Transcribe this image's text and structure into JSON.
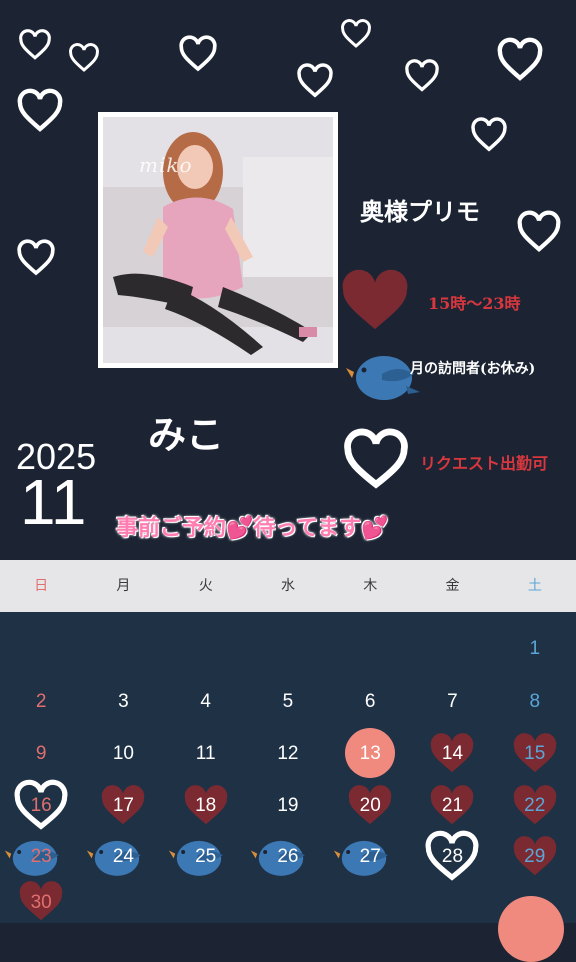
{
  "photo_watermark": "miko",
  "shop_name": "奥様プリモ",
  "legend": [
    {
      "icon": "heart-filled-icon",
      "label": "15時〜23時",
      "color": "#d8373e"
    },
    {
      "icon": "bluebird-icon",
      "label": "月の訪問者(お休み)",
      "color": "#ffffff"
    },
    {
      "icon": "heart-outline-icon",
      "label": "リクエスト出勤可",
      "color": "#d8373e"
    }
  ],
  "girl_name": "みこ",
  "year": "2025",
  "month": "11",
  "banner_text": "事前ご予約💕待ってます💕",
  "weekdays": [
    "日",
    "月",
    "火",
    "水",
    "木",
    "金",
    "土"
  ],
  "days": [
    "",
    "",
    "",
    "",
    "",
    "",
    "1",
    "2",
    "3",
    "4",
    "5",
    "6",
    "7",
    "8",
    "9",
    "10",
    "11",
    "12",
    "13",
    "14",
    "15",
    "16",
    "17",
    "18",
    "19",
    "20",
    "21",
    "22",
    "23",
    "24",
    "25",
    "26",
    "27",
    "28",
    "29",
    "30",
    "",
    "",
    "",
    "",
    "",
    ""
  ],
  "day_marks": {
    "13": "today-circle",
    "14": "heart-filled-icon",
    "15": "heart-filled-icon",
    "17": "heart-filled-icon",
    "18": "heart-filled-icon",
    "20": "heart-filled-icon",
    "21": "heart-filled-icon",
    "22": "heart-filled-icon",
    "29": "heart-filled-icon",
    "30": "heart-filled-icon",
    "16": "heart-outline-icon",
    "28": "heart-outline-icon",
    "23": "bluebird-icon",
    "24": "bluebird-icon",
    "25": "bluebird-icon",
    "26": "bluebird-icon",
    "27": "bluebird-icon"
  },
  "colors": {
    "background": "#1c2434",
    "calendar_background": "#1f3145",
    "heart_filled": "#8a2b33",
    "today": "#f08a7e",
    "bird": "#3c78b4"
  }
}
